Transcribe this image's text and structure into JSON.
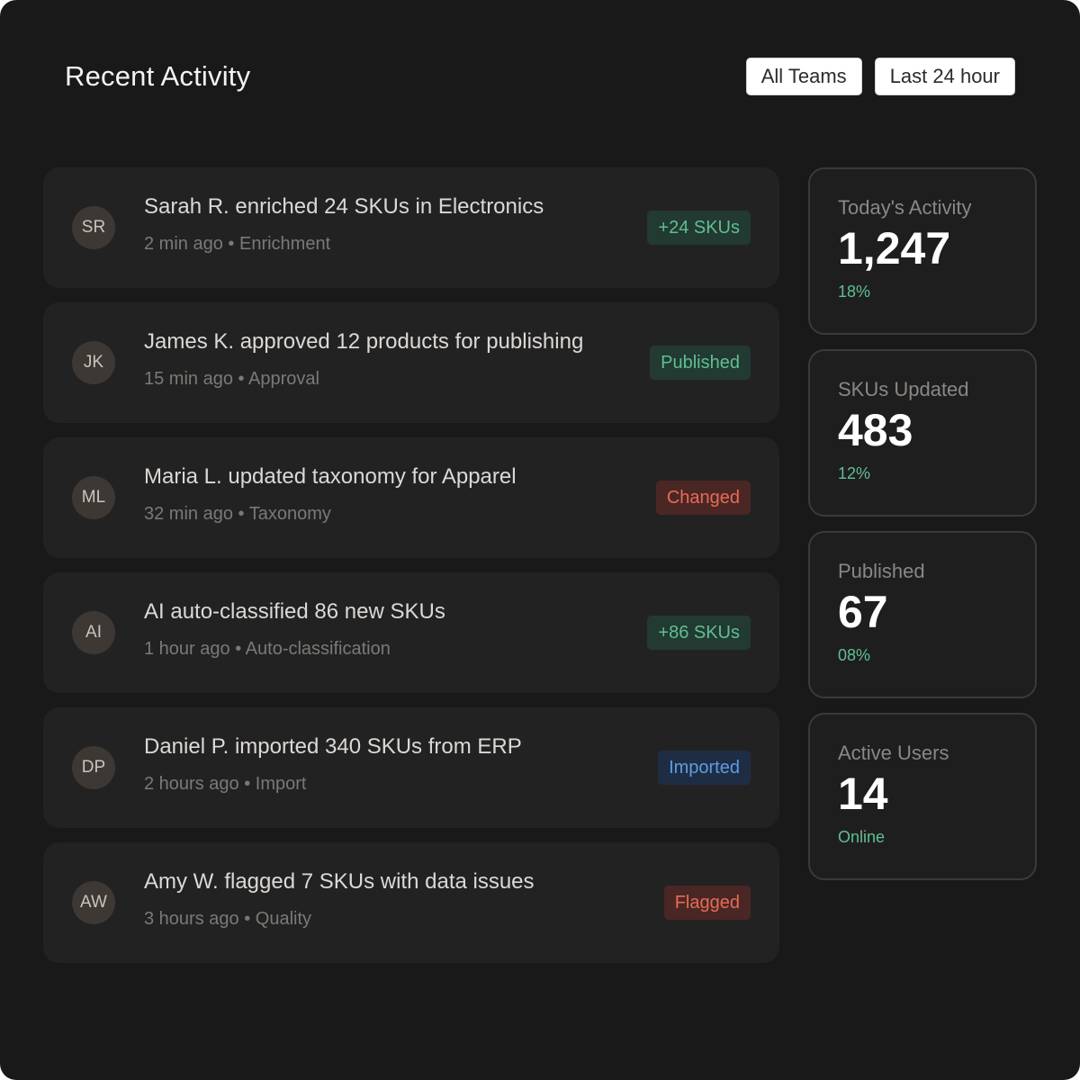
{
  "header": {
    "title": "Recent Activity",
    "filters": [
      {
        "label": "All Teams"
      },
      {
        "label": "Last 24 hour"
      }
    ]
  },
  "activities": [
    {
      "initials": "SR",
      "text": "Sarah R. enriched 24 SKUs in Electronics",
      "time": "2 min ago",
      "category": "Enrichment",
      "badge": "+24 SKUs",
      "badge_tone": "green"
    },
    {
      "initials": "JK",
      "text": "James K. approved 12 products for publishing",
      "time": "15 min ago",
      "category": "Approval",
      "badge": "Published",
      "badge_tone": "green"
    },
    {
      "initials": "ML",
      "text": "Maria L. updated taxonomy for Apparel",
      "time": "32 min ago",
      "category": "Taxonomy",
      "badge": "Changed",
      "badge_tone": "red"
    },
    {
      "initials": "AI",
      "text": "AI auto-classified 86 new SKUs",
      "time": "1 hour ago",
      "category": "Auto-classification",
      "badge": "+86 SKUs",
      "badge_tone": "green"
    },
    {
      "initials": "DP",
      "text": "Daniel P. imported 340 SKUs from ERP",
      "time": "2 hours ago",
      "category": "Import",
      "badge": "Imported",
      "badge_tone": "blue"
    },
    {
      "initials": "AW",
      "text": "Amy W. flagged 7 SKUs with data issues",
      "time": "3 hours ago",
      "category": "Quality",
      "badge": "Flagged",
      "badge_tone": "red"
    }
  ],
  "meta_separator": "•",
  "stats": [
    {
      "label": "Today's Activity",
      "value": "1,247",
      "change": "18%"
    },
    {
      "label": "SKUs Updated",
      "value": "483",
      "change": "12%"
    },
    {
      "label": "Published",
      "value": "67",
      "change": "08%"
    },
    {
      "label": "Active Users",
      "value": "14",
      "change": "Online"
    }
  ],
  "colors": {
    "background": "#1a191a",
    "card": "#232223",
    "positive": "#5fbf93",
    "negative": "#e76b57",
    "info": "#5b9de4"
  }
}
